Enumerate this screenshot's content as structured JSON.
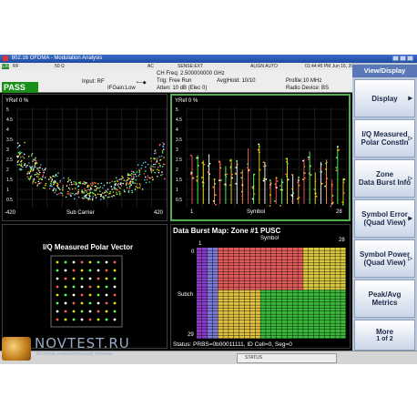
{
  "window": {
    "title": "802.16 OFDMA - Modulation Analysis"
  },
  "status_line": {
    "rf": "RF",
    "impedance": "50 Ω",
    "coupling": "AC",
    "ref": "SENSE:EXT",
    "align": "ALIGN AUTO",
    "datetime": "01:44:45 PM Jun 16, 2007"
  },
  "info": {
    "input": "Input: RF",
    "ifgain": "IFGain:Low",
    "ch_freq": "CH Freq: 2.500000000 GHz",
    "trig": "Trig: Free Run",
    "avg_hold": "Avg|Hold: 10/10",
    "atten": "Atten: 10 dB (Elec 0)",
    "profile": "Profile:10 MHz",
    "radio_device": "Radio Device: BS",
    "result": "PASS"
  },
  "panel_subcarrier": {
    "yref": "YRef  0 %",
    "x_left": "-420",
    "x_center": "Sub Carrier",
    "x_right": "420",
    "ticks": [
      "5",
      "4.5",
      "4",
      "3.5",
      "3",
      "2.5",
      "2",
      "1.5",
      "1",
      "0.5"
    ]
  },
  "panel_symbol": {
    "yref": "YRef  0 %",
    "x_left": "1",
    "x_center": "Symbol",
    "x_right": "28",
    "ticks": [
      "5",
      "4.5",
      "4",
      "3.5",
      "3",
      "2.5",
      "2",
      "1.5",
      "1",
      "0.5"
    ]
  },
  "panel_polar": {
    "title": "I/Q Measured Polar Vector"
  },
  "panel_burstmap": {
    "title": "Data Burst Map: Zone #1 PUSC",
    "x_label": "Symbol",
    "x_left": "1",
    "x_right": "28",
    "y_label": "Subch",
    "y_top": "0",
    "y_bottom": "29",
    "status": "Status: PRBS=0b00011111, ID Cell=0, Seg=0"
  },
  "softkeys": {
    "title": "View/Display",
    "keys": [
      {
        "line1": "Display",
        "line2": ""
      },
      {
        "line1": "I/Q Measured",
        "line2": "Polar Constln"
      },
      {
        "line1": "Zone",
        "line2": "Data Burst Info"
      },
      {
        "line1": "Symbol Error",
        "line2": "(Quad View)"
      },
      {
        "line1": "Symbol Power",
        "line2": "(Quad View)"
      },
      {
        "line1": "Peak/Avg",
        "line2": "Metrics"
      },
      {
        "line1": "More",
        "line2": "1 of 2"
      }
    ]
  },
  "bottom": {
    "status": "STATUS"
  },
  "watermark": {
    "text": "NOVTEST.RU",
    "sub": "Мотогии измерительной техники"
  },
  "colors": {
    "pass_green": "#1a8f1a",
    "softkey_bg": "#bcc7d6",
    "title_blue": "#1f4aa0"
  }
}
